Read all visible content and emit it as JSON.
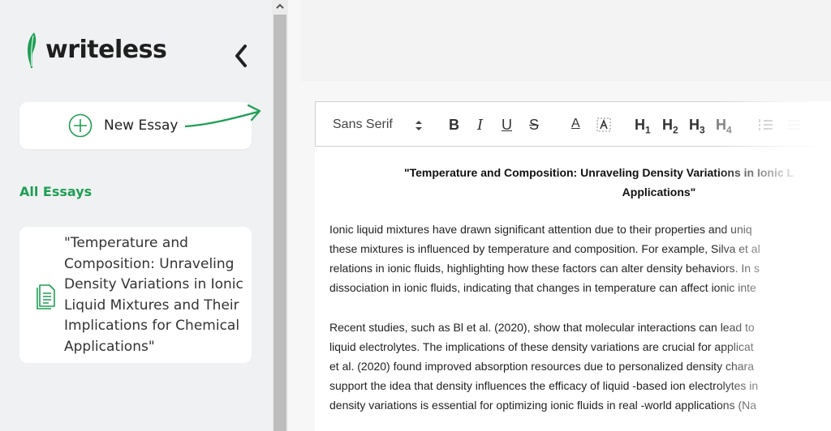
{
  "sidebar": {
    "logo_text": "writeless",
    "new_essay_label": "New Essay",
    "all_essays_heading": "All Essays",
    "essays": [
      {
        "title": "\"Temperature and Composition: Unraveling Density Variations in Ionic Liquid Mixtures and Their Implications for Chemical Applications\""
      }
    ]
  },
  "toolbar": {
    "font_family": "Sans Serif",
    "bold": "B",
    "italic": "I",
    "underline": "U",
    "strike": "S",
    "text_color": "A",
    "h1": "H",
    "h1_sub": "1",
    "h2": "H",
    "h2_sub": "2",
    "h3": "H",
    "h3_sub": "3",
    "h4": "H",
    "h4_sub": "4"
  },
  "document": {
    "title_line1": "\"Temperature and Composition: Unraveling Density Variations in Ionic L",
    "title_line2": "Applications\"",
    "paragraph1": [
      "Ionic liquid mixtures have drawn significant attention due to their properties and uniq",
      "these mixtures is influenced by temperature and composition. For example, Silva et al",
      "relations in ionic fluids, highlighting how these factors can alter density behaviors. In s",
      "dissociation in ionic fluids, indicating that changes in temperature can affect ionic inte"
    ],
    "paragraph2": [
      "Recent studies, such as Bl et al. (2020), show that molecular interactions can lead to",
      "liquid electrolytes. The implications of these density variations are crucial for applicat",
      "et al. (2020) found improved absorption resources due to personalized density chara",
      "support the idea that density influences the efficacy of liquid -based ion electrolytes in",
      "density variations is essential for optimizing ionic fluids in real -world applications (Na"
    ]
  },
  "colors": {
    "brand_green": "#1e9e55",
    "sidebar_bg": "#f0f1f2",
    "scrollbar_thumb": "#bdbdbd"
  },
  "icons": [
    "feather-logo-icon",
    "chevron-left-icon",
    "plus-circle-icon",
    "arrow-icon",
    "document-icon",
    "chevron-up-icon",
    "ordered-list-icon",
    "bullet-list-icon",
    "clear-format-icon"
  ]
}
